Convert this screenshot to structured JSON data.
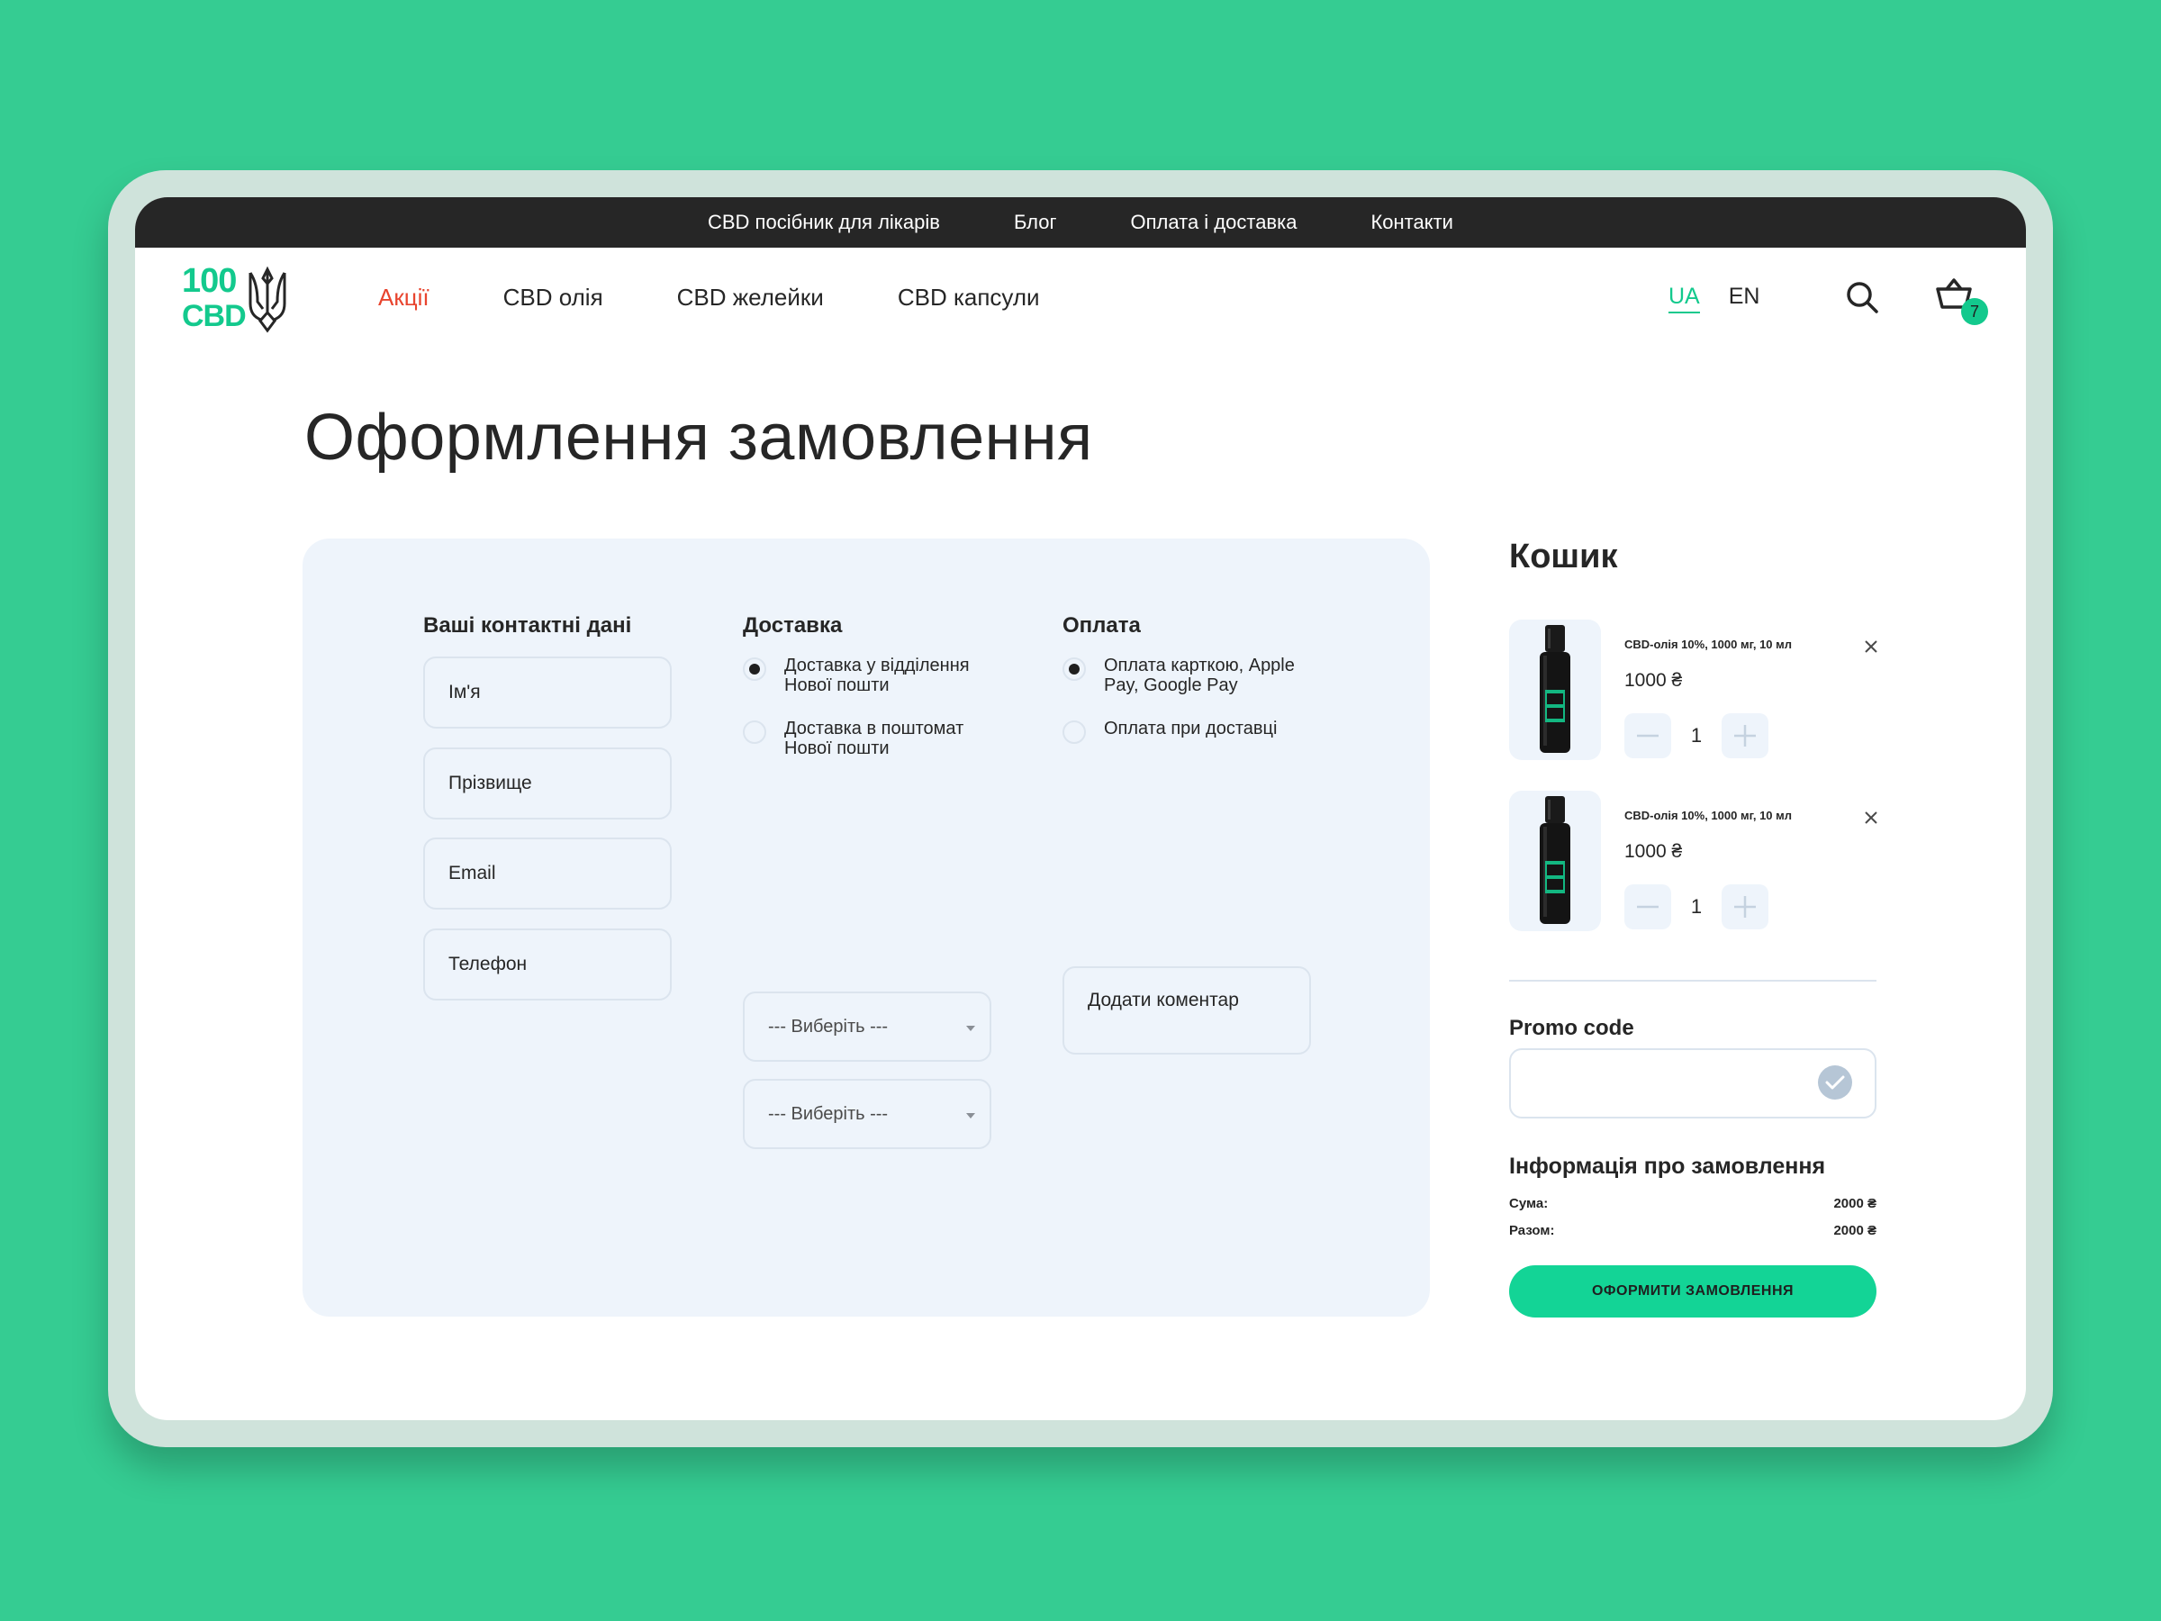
{
  "colors": {
    "background": "#35cc92",
    "accent": "#13c98d",
    "sale": "#e8442e",
    "panel": "#eef4fb",
    "topbar": "#262626"
  },
  "topbar": {
    "links": [
      "CBD посібник для лікарів",
      "Блог",
      "Оплата і доставка",
      "Контакти"
    ]
  },
  "logo": {
    "line1": "100",
    "line2": "CBD"
  },
  "nav": {
    "items": [
      "Акції",
      "CBD олія",
      "CBD желейки",
      "CBD капсули"
    ]
  },
  "lang": {
    "ua": "UA",
    "en": "EN",
    "active": "UA"
  },
  "header": {
    "cart_count": "7",
    "search_icon": "search-icon",
    "cart_icon": "basket-icon"
  },
  "page": {
    "title": "Оформлення замовлення"
  },
  "contact": {
    "title": "Ваші контактні дані",
    "name_placeholder": "Ім'я",
    "surname_placeholder": "Прізвище",
    "email_placeholder": "Email",
    "phone_placeholder": "Телефон"
  },
  "delivery": {
    "title": "Доставка",
    "options": [
      {
        "label": "Доставка у відділення Нової пошти",
        "selected": true
      },
      {
        "label": "Доставка в поштомат Нової пошти",
        "selected": false
      }
    ],
    "select1": "--- Виберіть ---",
    "select2": "--- Виберіть ---"
  },
  "payment": {
    "title": "Оплата",
    "options": [
      {
        "label": "Оплата карткою, Apple Pay, Google Pay",
        "selected": true
      },
      {
        "label": "Оплата при доставці",
        "selected": false
      }
    ],
    "comment_placeholder": "Додати коментар"
  },
  "cart": {
    "title": "Кошик",
    "items": [
      {
        "name": "CBD-олія 10%, 1000 мг, 10 мл",
        "price": "1000 ₴",
        "qty": "1",
        "label": "100 CBD"
      },
      {
        "name": "CBD-олія 10%, 1000 мг, 10 мл",
        "price": "1000 ₴",
        "qty": "1",
        "label": "100 CBD"
      }
    ]
  },
  "promo": {
    "label": "Promo code",
    "value": ""
  },
  "order_info": {
    "title": "Інформація про замовлення",
    "sum_label": "Сума:",
    "sum_value": "2000 ₴",
    "total_label": "Разом:",
    "total_value": "2000 ₴"
  },
  "submit": {
    "label": "ОФОРМИТИ ЗАМОВЛЕННЯ"
  }
}
